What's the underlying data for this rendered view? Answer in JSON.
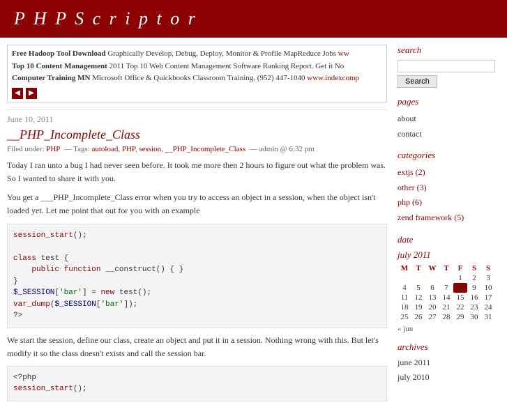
{
  "header": {
    "title": "P H P S c r i p t o r"
  },
  "ads": [
    {
      "title": "Free Hadoop Tool Download",
      "text": "Graphically Develop, Debug, Deploy, Monitor & Profile MapReduce Jobs",
      "link": "ww"
    },
    {
      "title": "Top 10 Content Management",
      "text": "2011 Top 10 Web Content Management Software Ranking Report. Get it No",
      "link": ""
    },
    {
      "title": "Computer Training MN",
      "text": "Microsoft Office & Quickbooks Classroom Training, (952) 447-1040",
      "link": "www.indexcomp"
    }
  ],
  "post": {
    "date": "June 10, 2011",
    "title": "__PHP_Incomplete_Class",
    "meta_filed": "Filed under:",
    "meta_category": "PHP",
    "meta_tags_label": "Tags:",
    "meta_tags": [
      "autoload",
      "PHP",
      "session",
      "__PHP_Incomplete_Class"
    ],
    "meta_author": "admin @ 6:32 pm",
    "para1": "Today I ran unto a bug I had never seen before. It took me more then 2 hours to figure out what the problem was. So I wanted to share it with you.",
    "para2": "You get a ___PHP_Incomplete_Class error when you try to access an object in a session, when the object isn't loaded yet. Let me point that out for you with an example",
    "code1": "session_start();\n\nclass test {\n    public function __construct() { }\n}\n$_SESSION['bar'] = new test();\nvar_dump($_SESSION['bar']);\n?>",
    "para3": "We start the session, define our class, create an object and put it in a session. Nothing wrong with this. But let's modify it so the class doesn't exists and call the session bar.",
    "code2": "<?php\nsession_start();"
  },
  "sidebar": {
    "search_label": "search",
    "search_placeholder": "",
    "search_button": "Search",
    "pages_label": "pages",
    "pages": [
      {
        "label": "about",
        "url": "#"
      },
      {
        "label": "contact",
        "url": "#"
      }
    ],
    "categories_label": "categories",
    "categories": [
      {
        "label": "extjs (2)",
        "url": "#"
      },
      {
        "label": "other (3)",
        "url": "#"
      },
      {
        "label": "php (6)",
        "url": "#"
      },
      {
        "label": "zend framework (5)",
        "url": "#"
      }
    ],
    "date_label": "date",
    "calendar_month": "july 2011",
    "calendar_headers": [
      "M",
      "T",
      "W",
      "T",
      "F",
      "S",
      "S"
    ],
    "calendar_weeks": [
      [
        "",
        "",
        "",
        "",
        "1",
        "2",
        "3"
      ],
      [
        "4",
        "5",
        "6",
        "7",
        "8",
        "9",
        "10"
      ],
      [
        "11",
        "12",
        "13",
        "14",
        "15",
        "16",
        "17"
      ],
      [
        "18",
        "19",
        "20",
        "21",
        "22",
        "23",
        "24"
      ],
      [
        "25",
        "26",
        "27",
        "28",
        "29",
        "30",
        "31"
      ]
    ],
    "calendar_today": "8",
    "calendar_prev": "« jun",
    "archives_label": "archives",
    "archives": [
      {
        "label": "june 2011",
        "url": "#"
      },
      {
        "label": "july 2010",
        "url": "#"
      }
    ]
  }
}
